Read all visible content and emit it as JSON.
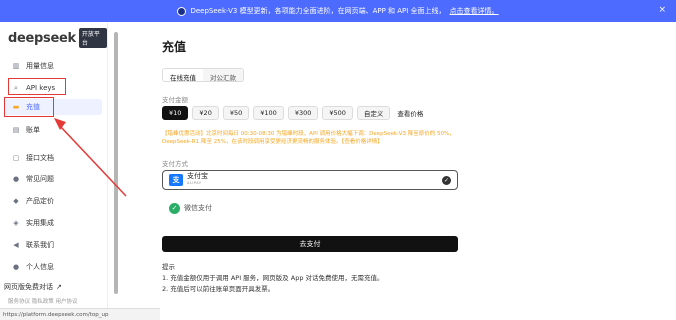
{
  "banner": {
    "text": "DeepSeek-V3 模型更新，各项能力全面进阶，在网页端、APP 和 API 全面上线，",
    "link": "点击查看详情。",
    "close_icon": "×"
  },
  "logo": {
    "text": "deepseek",
    "badge": "开放平台"
  },
  "sidebar": {
    "items": [
      {
        "label": "用量信息",
        "icon": "bar-chart-icon",
        "glyph": "▥"
      },
      {
        "label": "API keys",
        "icon": "search-icon",
        "glyph": "⌕"
      },
      {
        "label": "充值",
        "icon": "wallet-icon",
        "glyph": "▬"
      },
      {
        "label": "账单",
        "icon": "receipt-icon",
        "glyph": "▤"
      },
      {
        "label": "接口文档",
        "icon": "doc-icon",
        "glyph": "▢"
      },
      {
        "label": "常见问题",
        "icon": "help-icon",
        "glyph": "●"
      },
      {
        "label": "产品定价",
        "icon": "tag-icon",
        "glyph": "◆"
      },
      {
        "label": "实用集成",
        "icon": "puzzle-icon",
        "glyph": "◈"
      },
      {
        "label": "联系我们",
        "icon": "send-icon",
        "glyph": "◀"
      },
      {
        "label": "个人信息",
        "icon": "user-icon",
        "glyph": "●"
      }
    ],
    "feedback": "网页版免费对话",
    "feedback_arrow": "↗",
    "footer_links": "服务协议  隐私政策  用户协议"
  },
  "status_url": "https://platform.deepseek.com/top_up",
  "main": {
    "title": "充值",
    "tabs": [
      "在线充值",
      "对公汇款"
    ],
    "amount_label": "支付金额",
    "amounts": [
      "¥10",
      "¥20",
      "¥50",
      "¥100",
      "¥300",
      "¥500",
      "自定义"
    ],
    "pricing_link": "查看价格",
    "notice": "【错峰优惠活动】北京时间每日 00:30-08:30 为错峰时段，API 调用价格大幅下调：DeepSeek-V3 降至原价的 50%，DeepSeek-R1 降至 25%，在该时段调用享受更经济更流畅的服务体验。【查看价格详情】",
    "method_label": "支付方式",
    "alipay_label": "支付宝",
    "alipay_sub": "ALIPAY",
    "wechat_label": "微信支付",
    "pay_button": "去支付",
    "tips_title": "提示",
    "tips": [
      "1. 充值金额仅用于调用 API 服务，网页版及 App 对话免费使用，无需充值。",
      "2. 充值后可以前往账单页面开具发票。"
    ]
  },
  "colors": {
    "accent": "#4d6bfe",
    "warning": "#f5a623",
    "annotation": "#e53935"
  }
}
